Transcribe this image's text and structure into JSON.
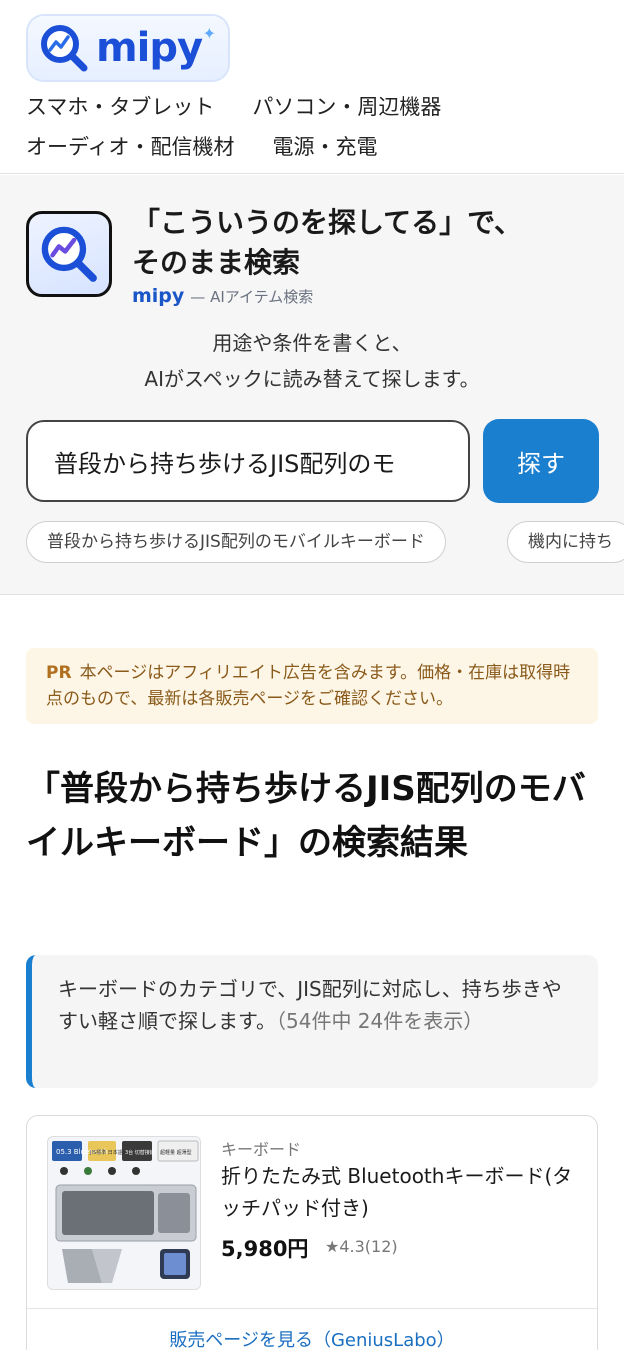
{
  "header": {
    "logo_text": "mipy",
    "nav": [
      [
        "スマホ・タブレット",
        "パソコン・周辺機器"
      ],
      [
        "オーディオ・配信機材",
        "電源・充電"
      ]
    ]
  },
  "hero": {
    "title_line1": "「こういうのを探してる」で、",
    "title_line2": "そのまま検索",
    "brand": "mipy",
    "brand_sub": "— AIアイテム検索",
    "desc_line1": "用途や条件を書くと、",
    "desc_line2": "AIがスペックに読み替えて探します。",
    "search_value": "普段から持ち歩けるJIS配列のモ",
    "search_button": "探す",
    "chips": [
      "普段から持ち歩けるJIS配列のモバイルキーボード",
      "機内に持ち"
    ]
  },
  "notice": {
    "pr": "PR",
    "text": "本ページはアフィリエイト広告を含みます。価格・在庫は取得時点のもので、最新は各販売ページをご確認ください。"
  },
  "results": {
    "title": "「普段から持ち歩けるJIS配列のモバイルキーボード」の検索結果"
  },
  "info": {
    "text": "キーボードのカテゴリで、JIS配列に対応し、持ち歩きやすい軽さ順で探します。",
    "count": "（54件中 24件を表示）"
  },
  "product": {
    "category": "キーボード",
    "name": "折りたたみ式 Bluetoothキーボード(タッチパッド付き)",
    "price": "5,980円",
    "rating": "★4.3(12)",
    "link": "販売ページを見る（GeniusLabo）",
    "thumb_badges": [
      "05.3 Bluetooth",
      "JIS標準 日本語配列",
      "3台 切替接続",
      "超軽量 超薄型"
    ]
  },
  "colors": {
    "accent": "#1b7fd0",
    "brand": "#1c4fd8",
    "notice_bg": "#fdf6e6"
  }
}
